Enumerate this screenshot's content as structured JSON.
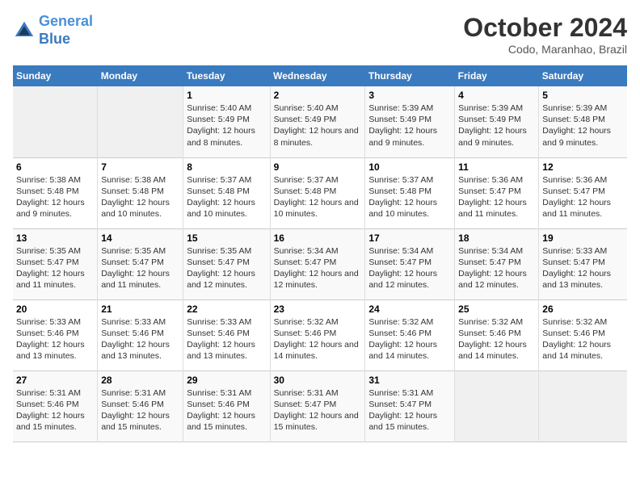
{
  "logo": {
    "line1": "General",
    "line2": "Blue"
  },
  "title": "October 2024",
  "subtitle": "Codo, Maranhao, Brazil",
  "days_of_week": [
    "Sunday",
    "Monday",
    "Tuesday",
    "Wednesday",
    "Thursday",
    "Friday",
    "Saturday"
  ],
  "weeks": [
    [
      {
        "day": "",
        "empty": true
      },
      {
        "day": "",
        "empty": true
      },
      {
        "day": "1",
        "sunrise": "Sunrise: 5:40 AM",
        "sunset": "Sunset: 5:49 PM",
        "daylight": "Daylight: 12 hours and 8 minutes."
      },
      {
        "day": "2",
        "sunrise": "Sunrise: 5:40 AM",
        "sunset": "Sunset: 5:49 PM",
        "daylight": "Daylight: 12 hours and 8 minutes."
      },
      {
        "day": "3",
        "sunrise": "Sunrise: 5:39 AM",
        "sunset": "Sunset: 5:49 PM",
        "daylight": "Daylight: 12 hours and 9 minutes."
      },
      {
        "day": "4",
        "sunrise": "Sunrise: 5:39 AM",
        "sunset": "Sunset: 5:49 PM",
        "daylight": "Daylight: 12 hours and 9 minutes."
      },
      {
        "day": "5",
        "sunrise": "Sunrise: 5:39 AM",
        "sunset": "Sunset: 5:48 PM",
        "daylight": "Daylight: 12 hours and 9 minutes."
      }
    ],
    [
      {
        "day": "6",
        "sunrise": "Sunrise: 5:38 AM",
        "sunset": "Sunset: 5:48 PM",
        "daylight": "Daylight: 12 hours and 9 minutes."
      },
      {
        "day": "7",
        "sunrise": "Sunrise: 5:38 AM",
        "sunset": "Sunset: 5:48 PM",
        "daylight": "Daylight: 12 hours and 10 minutes."
      },
      {
        "day": "8",
        "sunrise": "Sunrise: 5:37 AM",
        "sunset": "Sunset: 5:48 PM",
        "daylight": "Daylight: 12 hours and 10 minutes."
      },
      {
        "day": "9",
        "sunrise": "Sunrise: 5:37 AM",
        "sunset": "Sunset: 5:48 PM",
        "daylight": "Daylight: 12 hours and 10 minutes."
      },
      {
        "day": "10",
        "sunrise": "Sunrise: 5:37 AM",
        "sunset": "Sunset: 5:48 PM",
        "daylight": "Daylight: 12 hours and 10 minutes."
      },
      {
        "day": "11",
        "sunrise": "Sunrise: 5:36 AM",
        "sunset": "Sunset: 5:47 PM",
        "daylight": "Daylight: 12 hours and 11 minutes."
      },
      {
        "day": "12",
        "sunrise": "Sunrise: 5:36 AM",
        "sunset": "Sunset: 5:47 PM",
        "daylight": "Daylight: 12 hours and 11 minutes."
      }
    ],
    [
      {
        "day": "13",
        "sunrise": "Sunrise: 5:35 AM",
        "sunset": "Sunset: 5:47 PM",
        "daylight": "Daylight: 12 hours and 11 minutes."
      },
      {
        "day": "14",
        "sunrise": "Sunrise: 5:35 AM",
        "sunset": "Sunset: 5:47 PM",
        "daylight": "Daylight: 12 hours and 11 minutes."
      },
      {
        "day": "15",
        "sunrise": "Sunrise: 5:35 AM",
        "sunset": "Sunset: 5:47 PM",
        "daylight": "Daylight: 12 hours and 12 minutes."
      },
      {
        "day": "16",
        "sunrise": "Sunrise: 5:34 AM",
        "sunset": "Sunset: 5:47 PM",
        "daylight": "Daylight: 12 hours and 12 minutes."
      },
      {
        "day": "17",
        "sunrise": "Sunrise: 5:34 AM",
        "sunset": "Sunset: 5:47 PM",
        "daylight": "Daylight: 12 hours and 12 minutes."
      },
      {
        "day": "18",
        "sunrise": "Sunrise: 5:34 AM",
        "sunset": "Sunset: 5:47 PM",
        "daylight": "Daylight: 12 hours and 12 minutes."
      },
      {
        "day": "19",
        "sunrise": "Sunrise: 5:33 AM",
        "sunset": "Sunset: 5:47 PM",
        "daylight": "Daylight: 12 hours and 13 minutes."
      }
    ],
    [
      {
        "day": "20",
        "sunrise": "Sunrise: 5:33 AM",
        "sunset": "Sunset: 5:46 PM",
        "daylight": "Daylight: 12 hours and 13 minutes."
      },
      {
        "day": "21",
        "sunrise": "Sunrise: 5:33 AM",
        "sunset": "Sunset: 5:46 PM",
        "daylight": "Daylight: 12 hours and 13 minutes."
      },
      {
        "day": "22",
        "sunrise": "Sunrise: 5:33 AM",
        "sunset": "Sunset: 5:46 PM",
        "daylight": "Daylight: 12 hours and 13 minutes."
      },
      {
        "day": "23",
        "sunrise": "Sunrise: 5:32 AM",
        "sunset": "Sunset: 5:46 PM",
        "daylight": "Daylight: 12 hours and 14 minutes."
      },
      {
        "day": "24",
        "sunrise": "Sunrise: 5:32 AM",
        "sunset": "Sunset: 5:46 PM",
        "daylight": "Daylight: 12 hours and 14 minutes."
      },
      {
        "day": "25",
        "sunrise": "Sunrise: 5:32 AM",
        "sunset": "Sunset: 5:46 PM",
        "daylight": "Daylight: 12 hours and 14 minutes."
      },
      {
        "day": "26",
        "sunrise": "Sunrise: 5:32 AM",
        "sunset": "Sunset: 5:46 PM",
        "daylight": "Daylight: 12 hours and 14 minutes."
      }
    ],
    [
      {
        "day": "27",
        "sunrise": "Sunrise: 5:31 AM",
        "sunset": "Sunset: 5:46 PM",
        "daylight": "Daylight: 12 hours and 15 minutes."
      },
      {
        "day": "28",
        "sunrise": "Sunrise: 5:31 AM",
        "sunset": "Sunset: 5:46 PM",
        "daylight": "Daylight: 12 hours and 15 minutes."
      },
      {
        "day": "29",
        "sunrise": "Sunrise: 5:31 AM",
        "sunset": "Sunset: 5:46 PM",
        "daylight": "Daylight: 12 hours and 15 minutes."
      },
      {
        "day": "30",
        "sunrise": "Sunrise: 5:31 AM",
        "sunset": "Sunset: 5:47 PM",
        "daylight": "Daylight: 12 hours and 15 minutes."
      },
      {
        "day": "31",
        "sunrise": "Sunrise: 5:31 AM",
        "sunset": "Sunset: 5:47 PM",
        "daylight": "Daylight: 12 hours and 15 minutes."
      },
      {
        "day": "",
        "empty": true
      },
      {
        "day": "",
        "empty": true
      }
    ]
  ]
}
